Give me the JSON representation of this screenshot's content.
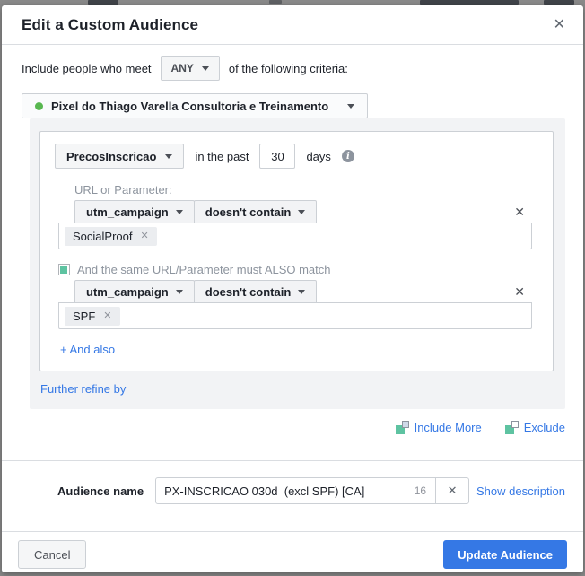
{
  "dialog": {
    "title": "Edit a Custom Audience"
  },
  "icons": {
    "close": "✕",
    "rule_remove": "✕",
    "token_remove": "✕",
    "clear_name": "✕",
    "info": "i"
  },
  "criteria": {
    "include_prefix": "Include people who meet",
    "match_type": "ANY",
    "include_suffix": "of the following criteria:",
    "pixel_name": "Pixel do Thiago Varella Consultoria e Treinamento",
    "event": {
      "name": "PrecosInscricao",
      "past_label": "in the past",
      "days_value": "30",
      "days_label": "days"
    },
    "url_param_label": "URL or Parameter:",
    "also_match_label": "And the same URL/Parameter must ALSO match",
    "rules": [
      {
        "field": "utm_campaign",
        "operator": "doesn't contain",
        "token": "SocialProof"
      },
      {
        "field": "utm_campaign",
        "operator": "doesn't contain",
        "token": "SPF"
      }
    ],
    "and_also": "+ And also",
    "further_refine": "Further refine by"
  },
  "section_actions": {
    "include_more": "Include More",
    "exclude": "Exclude"
  },
  "audience_name": {
    "label": "Audience name",
    "value": "PX-INSCRICAO 030d  (excl SPF) [CA]",
    "char_count": "16",
    "show_description": "Show description"
  },
  "footer": {
    "cancel": "Cancel",
    "submit": "Update Audience"
  },
  "colors": {
    "link_blue": "#3578e5",
    "primary_blue": "#3578e5",
    "teal": "#5ec3a1",
    "pixel_green": "#58b750"
  }
}
